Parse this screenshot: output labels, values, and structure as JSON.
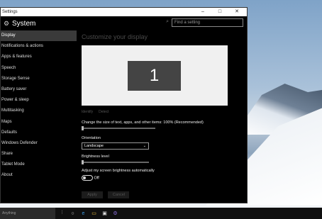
{
  "window": {
    "title": "Settings",
    "minimize": "–",
    "maximize": "□",
    "close": "✕"
  },
  "header": {
    "title": "System",
    "search_placeholder": "Find a setting"
  },
  "sidebar": {
    "items": [
      {
        "label": "Display",
        "active": true
      },
      {
        "label": "Notifications & actions"
      },
      {
        "label": "Apps & features"
      },
      {
        "label": "Speech"
      },
      {
        "label": "Storage Sense"
      },
      {
        "label": "Battery saver"
      },
      {
        "label": "Power & sleep"
      },
      {
        "label": "Multitasking"
      },
      {
        "label": "Maps"
      },
      {
        "label": "Defaults"
      },
      {
        "label": "Windows Defender"
      },
      {
        "label": "Share"
      },
      {
        "label": "Tablet Mode"
      },
      {
        "label": "About"
      }
    ]
  },
  "main": {
    "title": "Customize your display",
    "monitor_number": "1",
    "identify_link": "Identify",
    "detect_link": "Detect",
    "scale_label": "Change the size of text, apps, and other items: 100% (Recommended)",
    "orientation_label": "Orientation",
    "orientation_value": "Landscape",
    "brightness_label": "Brightness level",
    "auto_brightness_label": "Adjust my screen brightness automatically",
    "toggle_state": "Off",
    "apply_button": "Apply",
    "cancel_button": "Cancel"
  },
  "taskbar": {
    "search_placeholder": "Anything"
  },
  "colors": {
    "window_bg": "#000000",
    "active_item": "#3a3a3a",
    "accent": "#0078d7"
  }
}
